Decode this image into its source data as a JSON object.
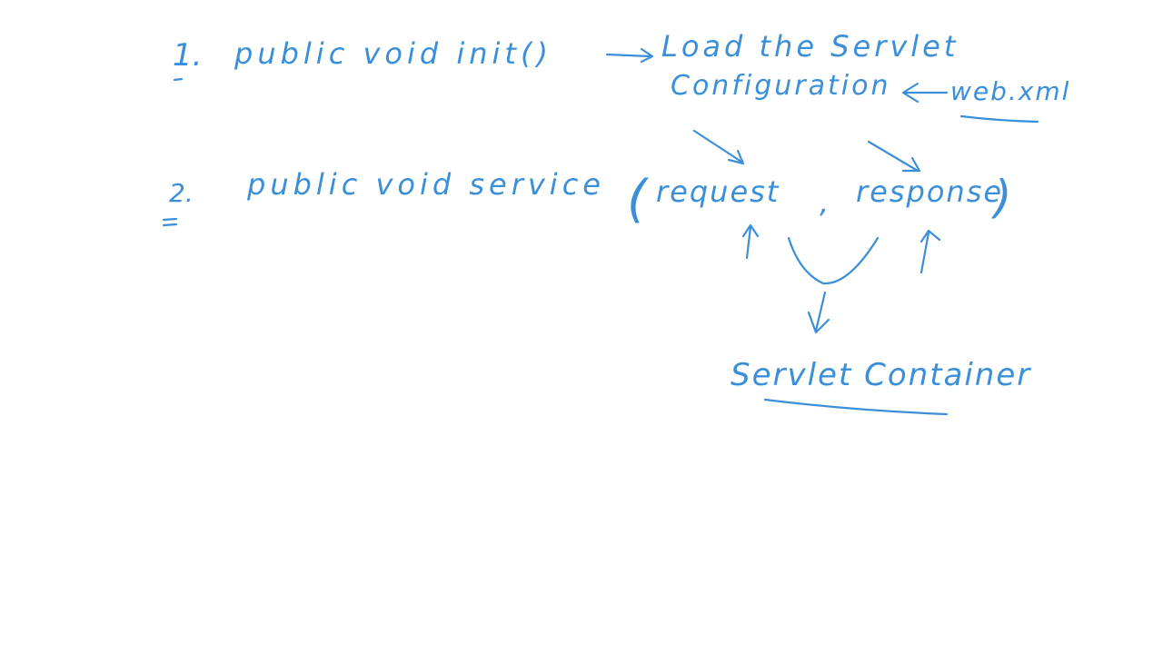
{
  "ink_color": "#3b8fd9",
  "background_color": "#ffffff",
  "notes": {
    "line1": {
      "number": "1.",
      "text": "public void init()",
      "annotation_line1": "Load the Servlet",
      "annotation_line2": "Configuration",
      "source_file": "web.xml"
    },
    "line2": {
      "number": "2.",
      "text_prefix": "public void service",
      "open_paren": "(",
      "param_request": "request",
      "comma": ",",
      "param_response": "response",
      "close_paren": ")",
      "container": "Servlet Container"
    }
  }
}
